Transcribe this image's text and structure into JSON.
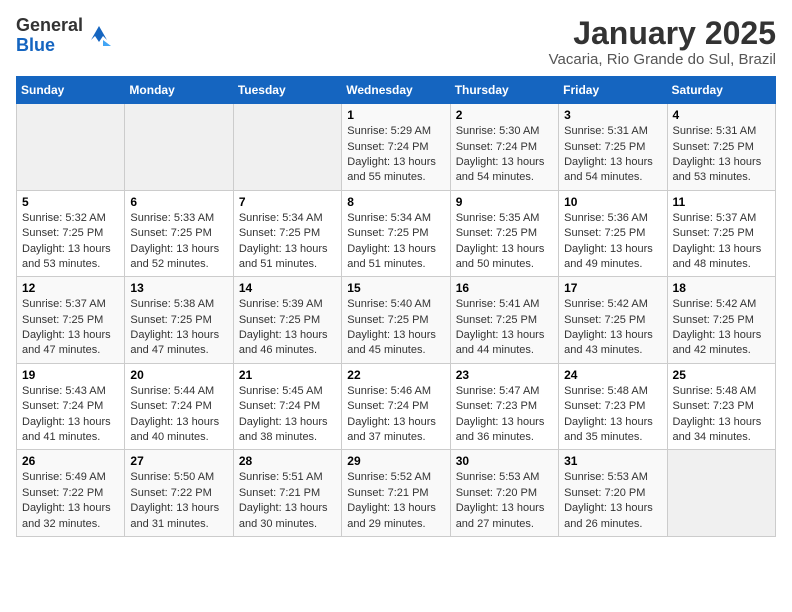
{
  "header": {
    "logo_general": "General",
    "logo_blue": "Blue",
    "title": "January 2025",
    "subtitle": "Vacaria, Rio Grande do Sul, Brazil"
  },
  "days_of_week": [
    "Sunday",
    "Monday",
    "Tuesday",
    "Wednesday",
    "Thursday",
    "Friday",
    "Saturday"
  ],
  "weeks": [
    [
      {
        "day": "",
        "sunrise": "",
        "sunset": "",
        "daylight": ""
      },
      {
        "day": "",
        "sunrise": "",
        "sunset": "",
        "daylight": ""
      },
      {
        "day": "",
        "sunrise": "",
        "sunset": "",
        "daylight": ""
      },
      {
        "day": "1",
        "sunrise": "Sunrise: 5:29 AM",
        "sunset": "Sunset: 7:24 PM",
        "daylight": "Daylight: 13 hours and 55 minutes."
      },
      {
        "day": "2",
        "sunrise": "Sunrise: 5:30 AM",
        "sunset": "Sunset: 7:24 PM",
        "daylight": "Daylight: 13 hours and 54 minutes."
      },
      {
        "day": "3",
        "sunrise": "Sunrise: 5:31 AM",
        "sunset": "Sunset: 7:25 PM",
        "daylight": "Daylight: 13 hours and 54 minutes."
      },
      {
        "day": "4",
        "sunrise": "Sunrise: 5:31 AM",
        "sunset": "Sunset: 7:25 PM",
        "daylight": "Daylight: 13 hours and 53 minutes."
      }
    ],
    [
      {
        "day": "5",
        "sunrise": "Sunrise: 5:32 AM",
        "sunset": "Sunset: 7:25 PM",
        "daylight": "Daylight: 13 hours and 53 minutes."
      },
      {
        "day": "6",
        "sunrise": "Sunrise: 5:33 AM",
        "sunset": "Sunset: 7:25 PM",
        "daylight": "Daylight: 13 hours and 52 minutes."
      },
      {
        "day": "7",
        "sunrise": "Sunrise: 5:34 AM",
        "sunset": "Sunset: 7:25 PM",
        "daylight": "Daylight: 13 hours and 51 minutes."
      },
      {
        "day": "8",
        "sunrise": "Sunrise: 5:34 AM",
        "sunset": "Sunset: 7:25 PM",
        "daylight": "Daylight: 13 hours and 51 minutes."
      },
      {
        "day": "9",
        "sunrise": "Sunrise: 5:35 AM",
        "sunset": "Sunset: 7:25 PM",
        "daylight": "Daylight: 13 hours and 50 minutes."
      },
      {
        "day": "10",
        "sunrise": "Sunrise: 5:36 AM",
        "sunset": "Sunset: 7:25 PM",
        "daylight": "Daylight: 13 hours and 49 minutes."
      },
      {
        "day": "11",
        "sunrise": "Sunrise: 5:37 AM",
        "sunset": "Sunset: 7:25 PM",
        "daylight": "Daylight: 13 hours and 48 minutes."
      }
    ],
    [
      {
        "day": "12",
        "sunrise": "Sunrise: 5:37 AM",
        "sunset": "Sunset: 7:25 PM",
        "daylight": "Daylight: 13 hours and 47 minutes."
      },
      {
        "day": "13",
        "sunrise": "Sunrise: 5:38 AM",
        "sunset": "Sunset: 7:25 PM",
        "daylight": "Daylight: 13 hours and 47 minutes."
      },
      {
        "day": "14",
        "sunrise": "Sunrise: 5:39 AM",
        "sunset": "Sunset: 7:25 PM",
        "daylight": "Daylight: 13 hours and 46 minutes."
      },
      {
        "day": "15",
        "sunrise": "Sunrise: 5:40 AM",
        "sunset": "Sunset: 7:25 PM",
        "daylight": "Daylight: 13 hours and 45 minutes."
      },
      {
        "day": "16",
        "sunrise": "Sunrise: 5:41 AM",
        "sunset": "Sunset: 7:25 PM",
        "daylight": "Daylight: 13 hours and 44 minutes."
      },
      {
        "day": "17",
        "sunrise": "Sunrise: 5:42 AM",
        "sunset": "Sunset: 7:25 PM",
        "daylight": "Daylight: 13 hours and 43 minutes."
      },
      {
        "day": "18",
        "sunrise": "Sunrise: 5:42 AM",
        "sunset": "Sunset: 7:25 PM",
        "daylight": "Daylight: 13 hours and 42 minutes."
      }
    ],
    [
      {
        "day": "19",
        "sunrise": "Sunrise: 5:43 AM",
        "sunset": "Sunset: 7:24 PM",
        "daylight": "Daylight: 13 hours and 41 minutes."
      },
      {
        "day": "20",
        "sunrise": "Sunrise: 5:44 AM",
        "sunset": "Sunset: 7:24 PM",
        "daylight": "Daylight: 13 hours and 40 minutes."
      },
      {
        "day": "21",
        "sunrise": "Sunrise: 5:45 AM",
        "sunset": "Sunset: 7:24 PM",
        "daylight": "Daylight: 13 hours and 38 minutes."
      },
      {
        "day": "22",
        "sunrise": "Sunrise: 5:46 AM",
        "sunset": "Sunset: 7:24 PM",
        "daylight": "Daylight: 13 hours and 37 minutes."
      },
      {
        "day": "23",
        "sunrise": "Sunrise: 5:47 AM",
        "sunset": "Sunset: 7:23 PM",
        "daylight": "Daylight: 13 hours and 36 minutes."
      },
      {
        "day": "24",
        "sunrise": "Sunrise: 5:48 AM",
        "sunset": "Sunset: 7:23 PM",
        "daylight": "Daylight: 13 hours and 35 minutes."
      },
      {
        "day": "25",
        "sunrise": "Sunrise: 5:48 AM",
        "sunset": "Sunset: 7:23 PM",
        "daylight": "Daylight: 13 hours and 34 minutes."
      }
    ],
    [
      {
        "day": "26",
        "sunrise": "Sunrise: 5:49 AM",
        "sunset": "Sunset: 7:22 PM",
        "daylight": "Daylight: 13 hours and 32 minutes."
      },
      {
        "day": "27",
        "sunrise": "Sunrise: 5:50 AM",
        "sunset": "Sunset: 7:22 PM",
        "daylight": "Daylight: 13 hours and 31 minutes."
      },
      {
        "day": "28",
        "sunrise": "Sunrise: 5:51 AM",
        "sunset": "Sunset: 7:21 PM",
        "daylight": "Daylight: 13 hours and 30 minutes."
      },
      {
        "day": "29",
        "sunrise": "Sunrise: 5:52 AM",
        "sunset": "Sunset: 7:21 PM",
        "daylight": "Daylight: 13 hours and 29 minutes."
      },
      {
        "day": "30",
        "sunrise": "Sunrise: 5:53 AM",
        "sunset": "Sunset: 7:20 PM",
        "daylight": "Daylight: 13 hours and 27 minutes."
      },
      {
        "day": "31",
        "sunrise": "Sunrise: 5:53 AM",
        "sunset": "Sunset: 7:20 PM",
        "daylight": "Daylight: 13 hours and 26 minutes."
      },
      {
        "day": "",
        "sunrise": "",
        "sunset": "",
        "daylight": ""
      }
    ]
  ]
}
